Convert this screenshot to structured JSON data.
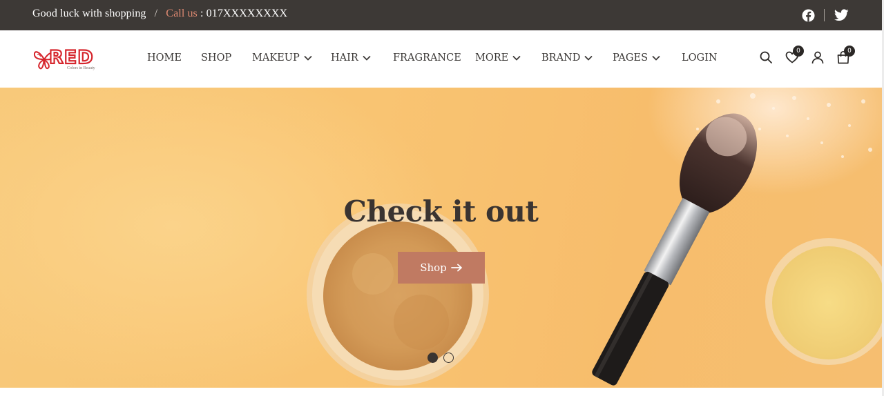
{
  "topbar": {
    "greeting": "Good luck with shopping",
    "separator": "/",
    "call_label": "Call us",
    "phone": ": 017XXXXXXXX",
    "social": [
      "facebook-icon",
      "twitter-icon"
    ]
  },
  "brand": {
    "logo_text": "RED",
    "logo_tagline": "Colors in Beauty"
  },
  "nav": {
    "items": [
      {
        "label": "HOME",
        "dropdown": false
      },
      {
        "label": "SHOP",
        "dropdown": false
      },
      {
        "label": "MAKEUP",
        "dropdown": true
      },
      {
        "label": "HAIR",
        "dropdown": true
      },
      {
        "label": "FRAGRANCE",
        "dropdown": false
      },
      {
        "label": "MORE",
        "dropdown": true
      },
      {
        "label": "BRAND",
        "dropdown": true
      },
      {
        "label": "PAGES",
        "dropdown": true
      },
      {
        "label": "LOGIN",
        "dropdown": false
      }
    ],
    "wishlist_count": "0",
    "cart_count": "0"
  },
  "hero": {
    "title": "Check it out",
    "button_label": "Shop",
    "slides_total": 2,
    "active_slide": 1
  },
  "colors": {
    "topbar_bg": "#3d3936",
    "accent": "#c07a62",
    "call_text": "#e08a72",
    "logo_red": "#d6262d",
    "hero_bg": "#f8c97a"
  }
}
